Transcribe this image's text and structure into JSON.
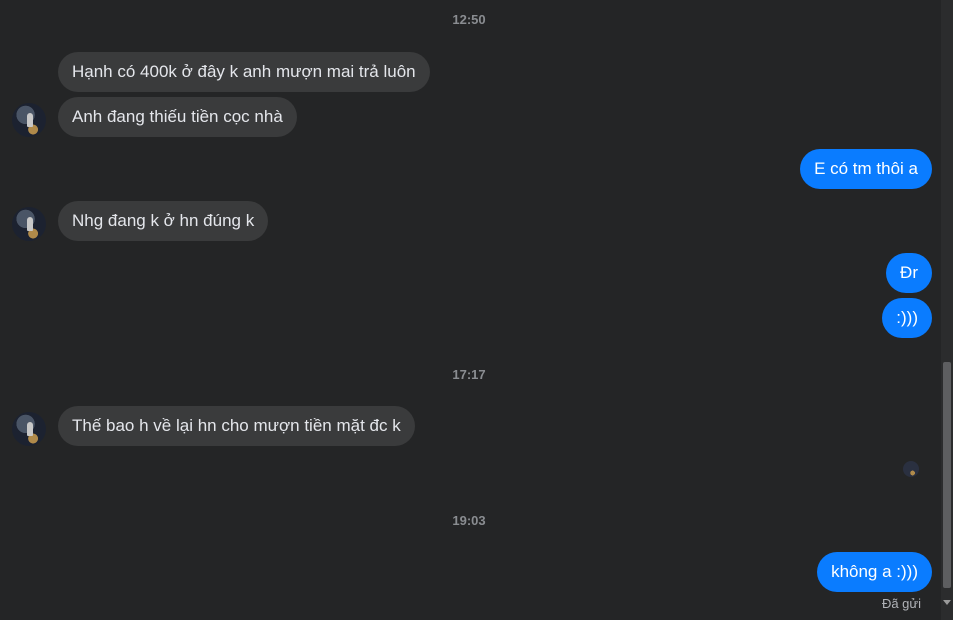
{
  "timestamps": [
    "12:50",
    "17:17",
    "19:03"
  ],
  "messages": [
    {
      "text": "Hạnh có 400k ở đây k anh mượn mai trả luôn",
      "direction": "incoming"
    },
    {
      "text": "Anh đang thiếu tiền cọc nhà",
      "direction": "incoming"
    },
    {
      "text": "E có tm thôi a",
      "direction": "outgoing"
    },
    {
      "text": "Nhg đang k ở hn đúng k",
      "direction": "incoming"
    },
    {
      "text": "Đr",
      "direction": "outgoing"
    },
    {
      "text": ":)))",
      "direction": "outgoing"
    },
    {
      "text": "Thế bao h về lại hn cho mượn tiền mặt đc k",
      "direction": "incoming"
    },
    {
      "text": "không a :)))",
      "direction": "outgoing"
    }
  ],
  "status_text": "Đã gửi",
  "colors": {
    "background": "#242526",
    "incoming_bubble": "#3a3b3c",
    "outgoing_bubble": "#0a7cff",
    "timestamp": "#8a8d91"
  }
}
